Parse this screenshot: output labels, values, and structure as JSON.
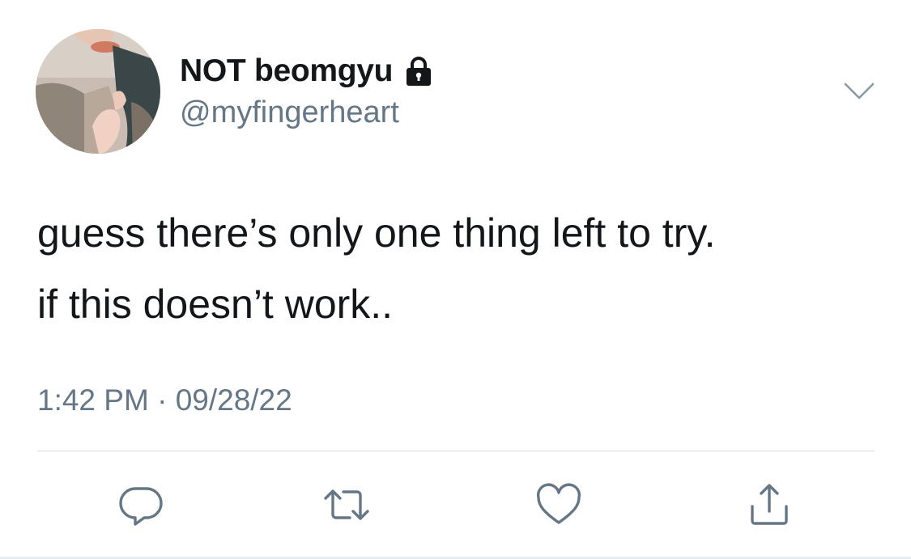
{
  "user": {
    "display_name": "NOT beomgyu",
    "handle": "@myfingerheart",
    "protected_icon": "lock-icon",
    "avatar": "profile-photo"
  },
  "tweet": {
    "lines": [
      "guess there’s only one thing left to try.",
      "if this doesn’t work.."
    ],
    "time": "1:42 PM",
    "separator": "·",
    "date": "09/28/22"
  },
  "menu": {
    "icon": "chevron-down-icon"
  },
  "actions": [
    {
      "name": "reply",
      "icon": "reply-icon"
    },
    {
      "name": "retweet",
      "icon": "retweet-icon"
    },
    {
      "name": "like",
      "icon": "heart-icon"
    },
    {
      "name": "share",
      "icon": "share-icon"
    }
  ],
  "colors": {
    "text_primary": "#14171a",
    "text_secondary": "#657786",
    "divider": "#d8dee2",
    "background": "#ffffff"
  }
}
